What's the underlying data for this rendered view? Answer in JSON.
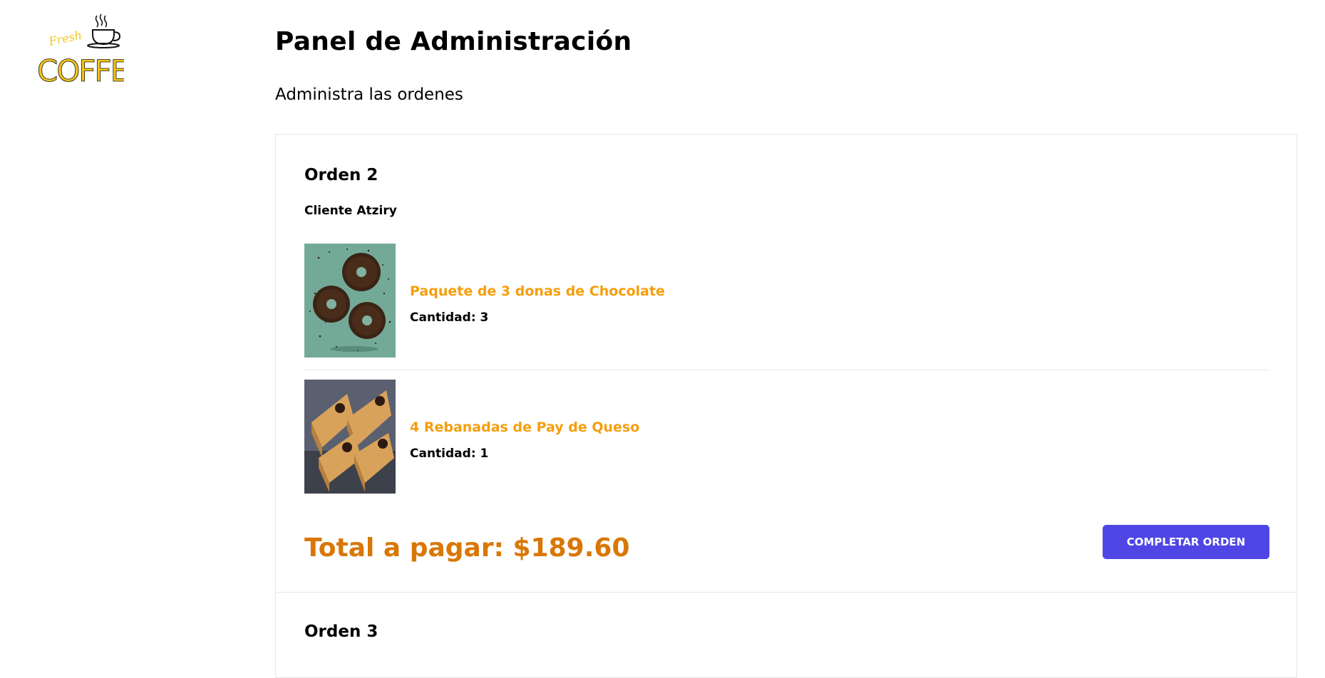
{
  "logo": {
    "script_text": "Fresh",
    "word_text": "COFFEE",
    "brand_color": "#f5c518"
  },
  "header": {
    "title": "Panel de Administración",
    "subtitle": "Administra las ordenes"
  },
  "orders": [
    {
      "title": "Orden 2",
      "client": "Cliente Atziry",
      "products": [
        {
          "name": "Paquete de 3 donas de Chocolate",
          "quantity": "Cantidad: 3",
          "image": "chocolate-donuts"
        },
        {
          "name": "4 Rebanadas de Pay de Queso",
          "quantity": "Cantidad: 1",
          "image": "cheesecake-slices"
        }
      ],
      "total": "Total a pagar: $189.60",
      "action_label": "COMPLETAR ORDEN"
    },
    {
      "title": "Orden 3"
    }
  ],
  "colors": {
    "accent_button": "#4f46e5",
    "product_name": "#f59e0b",
    "total": "#d97706"
  }
}
